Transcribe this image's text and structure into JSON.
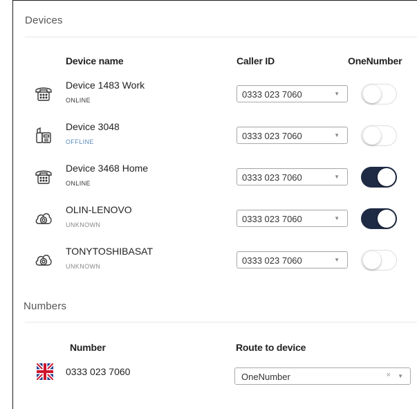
{
  "devices_section": {
    "title": "Devices",
    "columns": {
      "device_name": "Device name",
      "caller_id": "Caller ID",
      "onenumber": "OneNumber"
    },
    "rows": [
      {
        "name": "Device 1483 Work",
        "status": "ONLINE",
        "icon": "desk-phone-icon",
        "caller_id": "0333 023 7060",
        "onenumber": false
      },
      {
        "name": "Device 3048",
        "status": "OFFLINE",
        "icon": "cordless-phone-icon",
        "caller_id": "0333 023 7060",
        "onenumber": false
      },
      {
        "name": "Device 3468 Home",
        "status": "ONLINE",
        "icon": "desk-phone-icon",
        "caller_id": "0333 023 7060",
        "onenumber": true
      },
      {
        "name": "OLIN-LENOVO",
        "status": "UNKNOWN",
        "icon": "softphone-cloud-icon",
        "caller_id": "0333 023 7060",
        "onenumber": true
      },
      {
        "name": "TONYTOSHIBASAT",
        "status": "UNKNOWN",
        "icon": "softphone-cloud-icon",
        "caller_id": "0333 023 7060",
        "onenumber": false
      }
    ]
  },
  "numbers_section": {
    "title": "Numbers",
    "columns": {
      "number": "Number",
      "route": "Route to device"
    },
    "rows": [
      {
        "number": "0333 023 7060",
        "flag": "uk-flag-icon",
        "route": "OneNumber",
        "clear": "×",
        "caret": "▼"
      }
    ]
  },
  "select_caret": "▼",
  "colors": {
    "toggle_on": "#1f2a44",
    "offline_status": "#5b8bbf"
  }
}
